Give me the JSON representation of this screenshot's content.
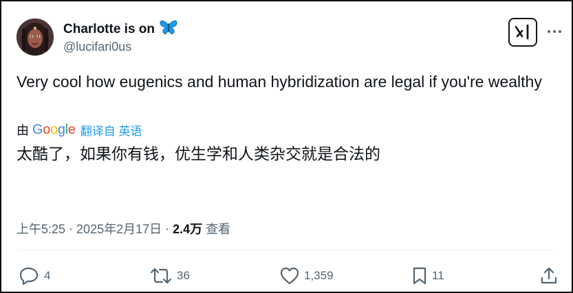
{
  "author": {
    "display_name": "Charlotte is on",
    "name_emoji": "butterfly-icon",
    "handle": "@lucifari0us"
  },
  "header": {
    "xai_icon": "grok-xai-icon",
    "more_icon": "more-horizontal-icon"
  },
  "tweet": {
    "text": "Very cool how eugenics and human hybridization are legal if you're wealthy"
  },
  "translation": {
    "by_label": "由",
    "provider": "Google",
    "link_label": "翻译自 英语",
    "translated_text": "太酷了，如果你有钱，优生学和人类杂交就是合法的"
  },
  "meta": {
    "time": "上午5:25",
    "date": "2025年2月17日",
    "separator": "·",
    "views_count": "2.4万",
    "views_label": "查看"
  },
  "actions": {
    "reply_count": "4",
    "retweet_count": "36",
    "like_count": "1,359",
    "bookmark_count": "11"
  },
  "colors": {
    "text_primary": "#0f1419",
    "text_secondary": "#536471",
    "link": "#1d9bf0",
    "butterfly": "#1d9bf0"
  }
}
